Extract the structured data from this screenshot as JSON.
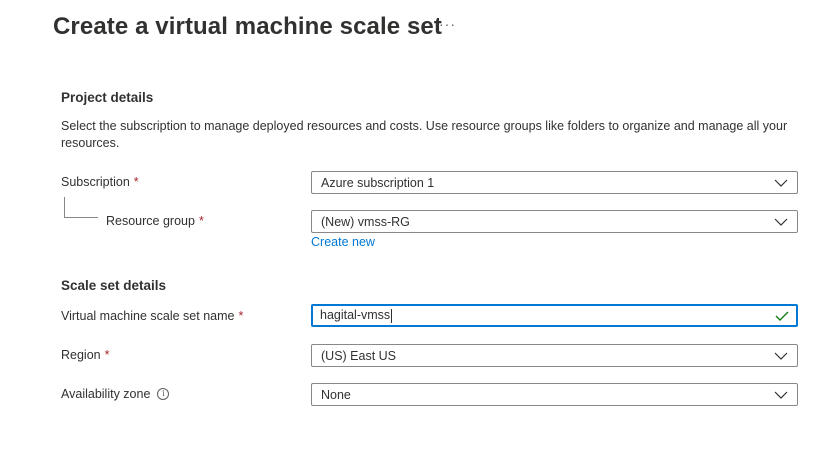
{
  "header": {
    "title": "Create a virtual machine scale set",
    "more_label": "···"
  },
  "project_details": {
    "heading": "Project details",
    "description": "Select the subscription to manage deployed resources and costs. Use resource groups like folders to organize and manage all your resources.",
    "subscription": {
      "label": "Subscription",
      "required": "*",
      "value": "Azure subscription 1"
    },
    "resource_group": {
      "label": "Resource group",
      "required": "*",
      "value": "(New) vmss-RG",
      "create_new_link": "Create new"
    }
  },
  "scale_set_details": {
    "heading": "Scale set details",
    "name": {
      "label": "Virtual machine scale set name",
      "required": "*",
      "value": "hagital-vmss"
    },
    "region": {
      "label": "Region",
      "required": "*",
      "value": "(US) East US"
    },
    "availability_zone": {
      "label": "Availability zone",
      "info_icon": "i",
      "value": "None"
    }
  },
  "colors": {
    "accent": "#0078d4",
    "required": "#a4262c",
    "success": "#107c10",
    "text": "#323130",
    "border": "#8a8886"
  },
  "icons": {
    "more": "more-horizontal-icon",
    "chevron": "chevron-down-icon",
    "check": "checkmark-icon",
    "info": "info-icon"
  }
}
